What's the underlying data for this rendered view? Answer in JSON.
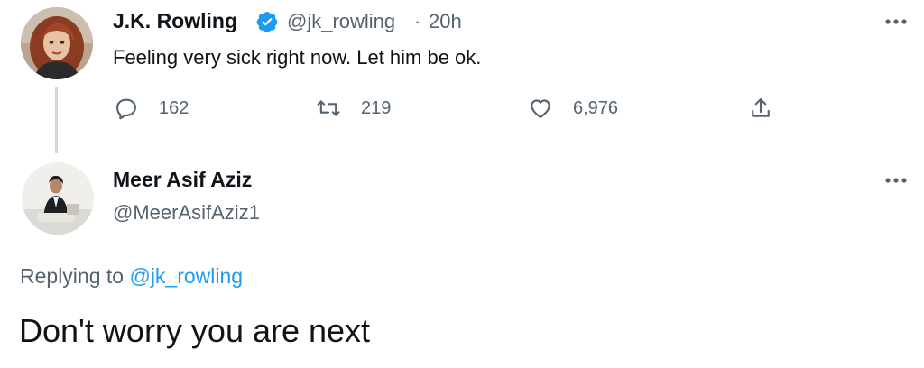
{
  "original_tweet": {
    "author_name": "J.K. Rowling",
    "handle": "@jk_rowling",
    "separator": "·",
    "time": "20h",
    "text": "Feeling very sick right now. Let him be ok.",
    "verified": true,
    "actions": {
      "reply_icon": "comment-icon",
      "reply_count": "162",
      "retweet_icon": "retweet-icon",
      "retweet_count": "219",
      "like_icon": "heart-icon",
      "like_count": "6,976",
      "share_icon": "share-icon"
    }
  },
  "reply_tweet": {
    "author_name": "Meer Asif Aziz",
    "handle": "@MeerAsifAziz1",
    "replying_prefix": "Replying to",
    "replying_handle": "@jk_rowling",
    "text": "Don't worry you are next"
  },
  "colors": {
    "text_primary": "#0f1419",
    "text_secondary": "#536471",
    "link_blue": "#1d9bf0",
    "thread_line": "#cfd9de"
  }
}
